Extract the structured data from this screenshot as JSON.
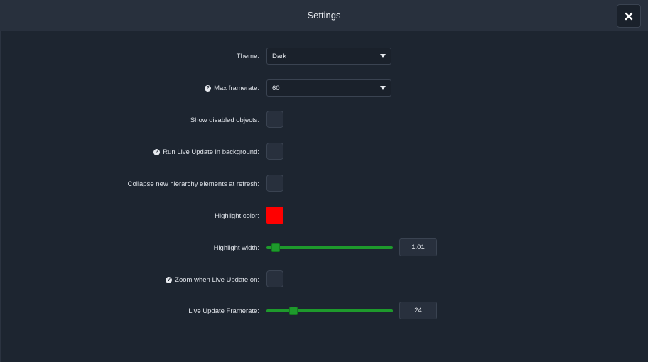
{
  "window": {
    "title": "Settings"
  },
  "colors": {
    "highlight": "#ff0000",
    "accent": "#1e9a2c"
  },
  "settings": {
    "theme": {
      "label": "Theme:",
      "value": "Dark"
    },
    "max_framerate": {
      "label": "Max framerate:",
      "value": "60",
      "help_icon": "help-icon"
    },
    "show_disabled": {
      "label": "Show disabled objects:",
      "checked": false
    },
    "run_live_update": {
      "label": "Run Live Update in background:",
      "checked": false,
      "help_icon": "help-icon"
    },
    "collapse_hierarchy": {
      "label": "Collapse new hierarchy elements at refresh:",
      "checked": false
    },
    "highlight_color": {
      "label": "Highlight color:"
    },
    "highlight_width": {
      "label": "Highlight width:",
      "value": "1.01",
      "fraction": 0.04
    },
    "zoom_live_update": {
      "label": "Zoom when Live Update on:",
      "checked": false,
      "help_icon": "help-icon"
    },
    "live_update_framerate": {
      "label": "Live Update Framerate:",
      "value": "24",
      "fraction": 0.19
    }
  }
}
